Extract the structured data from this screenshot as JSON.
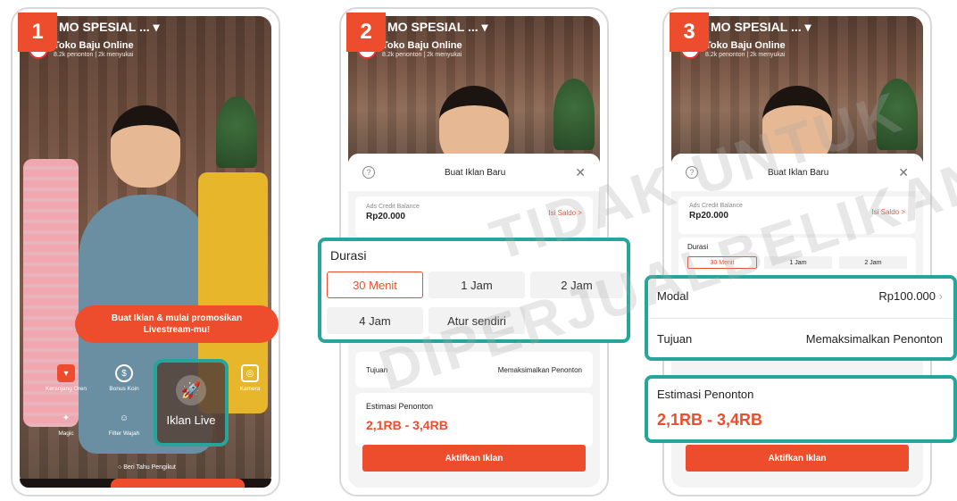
{
  "steps": [
    "1",
    "2",
    "3"
  ],
  "live": {
    "title": "MO SPESIAL ... ▾",
    "shop_name": "Toko Baju Online",
    "shop_stats": "8.2k penonton | 2k menyukai"
  },
  "screen1": {
    "promo_label": "Buat Iklan & mulai promosikan Livestream-mu!",
    "tools": [
      "Keranjang Oren",
      "Bonus Koin",
      "Kamera",
      "Magic",
      "Filter Wajah"
    ],
    "iklan_live_label": "Iklan Live",
    "followers_text": "Beri Tahu Pengikut"
  },
  "sheet": {
    "title": "Buat Iklan Baru",
    "balance_label": "Ads Credit Balance",
    "balance_value": "Rp20.000",
    "topup_label": "Isi Saldo >",
    "duration_label": "Durasi",
    "duration_options": [
      "30 Menit",
      "1 Jam",
      "2 Jam",
      "4 Jam",
      "Atur sendiri"
    ],
    "selected_duration": "30 Menit",
    "modal_label": "Modal",
    "modal_value": "Rp100.000",
    "tujuan_label": "Tujuan",
    "tujuan_value": "Memaksimalkan Penonton",
    "estimate_label": "Estimasi Penonton",
    "estimate_value": "2,1RB - 3,4RB",
    "activate_label": "Aktifkan Iklan"
  },
  "watermark": {
    "line1": "TIDAK UNTUK",
    "line2": "DIPERJUALBELIKAN"
  },
  "colors": {
    "accent": "#ee4d2d",
    "highlight": "#26a69a"
  }
}
